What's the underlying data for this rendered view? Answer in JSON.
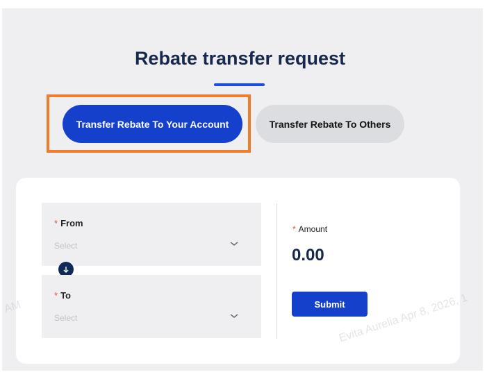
{
  "page": {
    "title": "Rebate transfer request"
  },
  "tabs": [
    {
      "label": "Transfer Rebate To Your Account",
      "active": true
    },
    {
      "label": "Transfer Rebate To Others",
      "active": false
    }
  ],
  "form": {
    "required_mark": "*",
    "from": {
      "label": "From",
      "placeholder": "Select"
    },
    "to": {
      "label": "To",
      "placeholder": "Select"
    },
    "amount": {
      "label": "Amount",
      "value": "0.00"
    },
    "submit_label": "Submit"
  },
  "watermark": {
    "right": "Evita Aurelia Apr 8, 2026, 1",
    "left": "AM"
  },
  "colors": {
    "accent": "#1440cc",
    "title": "#16294d",
    "highlight": "#ef7d2c",
    "required": "#e0533d"
  },
  "icons": [
    "chevron-down-icon",
    "arrow-down-icon"
  ]
}
